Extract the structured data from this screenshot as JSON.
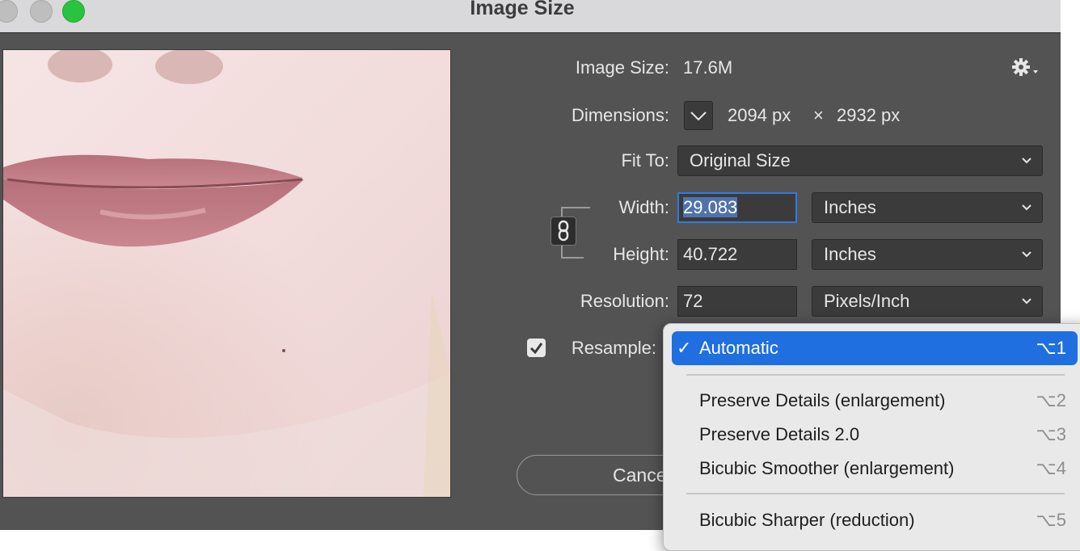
{
  "window": {
    "title": "Image Size"
  },
  "image_size": {
    "label": "Image Size:",
    "value": "17.6M"
  },
  "dimensions": {
    "label": "Dimensions:",
    "width": "2094 px",
    "times": "×",
    "height": "2932 px"
  },
  "fit_to": {
    "label": "Fit To:",
    "value": "Original Size"
  },
  "width": {
    "label": "Width:",
    "value": "29.083",
    "unit": "Inches"
  },
  "height": {
    "label": "Height:",
    "value": "40.722",
    "unit": "Inches"
  },
  "resolution": {
    "label": "Resolution:",
    "value": "72",
    "unit": "Pixels/Inch"
  },
  "resample": {
    "label": "Resample:",
    "checked": true
  },
  "buttons": {
    "cancel": "Cance"
  },
  "resample_menu": {
    "items": [
      {
        "label": "Automatic",
        "shortcut": "⌥1",
        "checked": true
      },
      {
        "label": "Preserve Details (enlargement)",
        "shortcut": "⌥2"
      },
      {
        "label": "Preserve Details 2.0",
        "shortcut": "⌥3"
      },
      {
        "label": "Bicubic Smoother (enlargement)",
        "shortcut": "⌥4"
      },
      {
        "label": "Bicubic Sharper (reduction)",
        "shortcut": "⌥5"
      }
    ]
  },
  "icons": {
    "gear": "gear-icon",
    "link": "constrain-proportions-link-icon",
    "chevron": "chevron-down-icon",
    "check": "check-icon"
  },
  "colors": {
    "accent": "#1f6fe0",
    "dialog_bg": "#535353",
    "zoom_button": "#2ac33f"
  }
}
